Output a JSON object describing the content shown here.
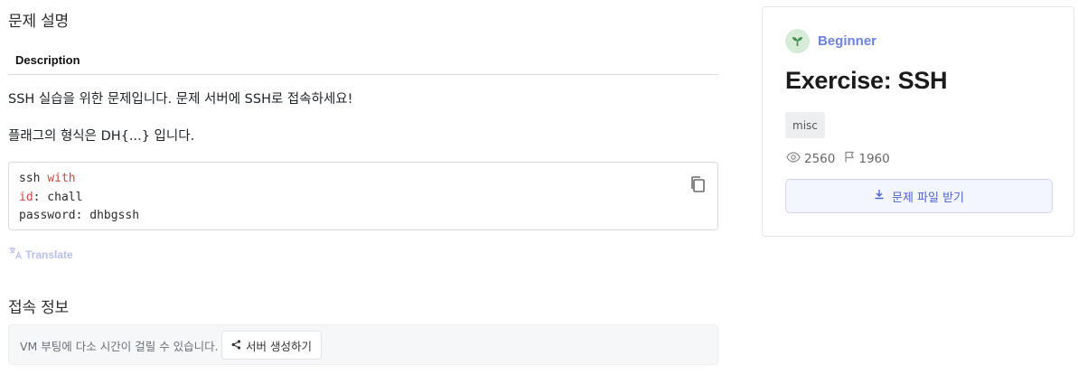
{
  "left": {
    "section_title_problem": "문제 설명",
    "tab_description": "Description",
    "paragraph_1": "SSH 실습을 위한 문제입니다. 문제 서버에 SSH로 접속하세요!",
    "paragraph_2": "플래그의 형식은 DH{...} 입니다.",
    "code": {
      "line1_cmd": "ssh ",
      "line1_kw": "with",
      "line2_kw": "id",
      "line2_rest": ": chall",
      "line3": "password: dhbgssh"
    },
    "translate_label": "Translate",
    "section_title_connect": "접속 정보",
    "vm_notice": "VM 부팅에 다소 시간이 걸릴 수 있습니다.",
    "create_server_label": "서버 생성하기"
  },
  "card": {
    "level": "Beginner",
    "title": "Exercise: SSH",
    "tag": "misc",
    "views": "2560",
    "solves": "1960",
    "download_label": "문제 파일 받기"
  },
  "colors": {
    "accent": "#6e82e0",
    "keyword": "#d0473f",
    "level_bg": "#d6ecd9"
  },
  "icons": [
    "copy-icon",
    "translate-icon",
    "share-icon",
    "sprout-icon",
    "eye-icon",
    "flag-icon",
    "download-icon"
  ]
}
